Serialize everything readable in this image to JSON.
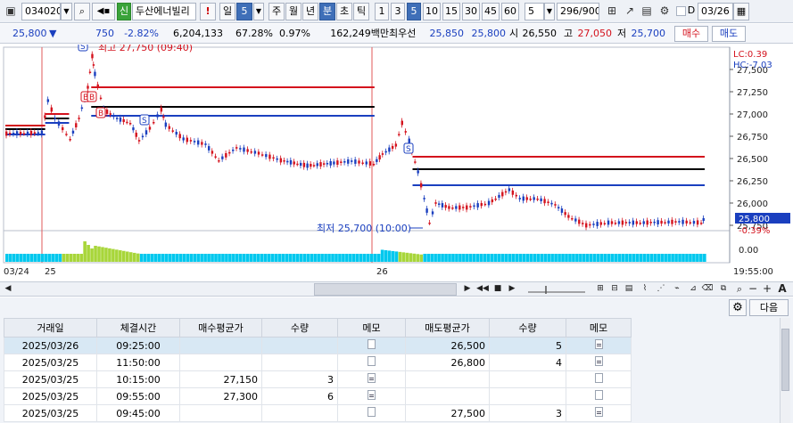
{
  "toolbar": {
    "code": "034020",
    "name_badge": "신",
    "name": "두산에너빌리",
    "warn": "!",
    "periods": [
      "일",
      "5",
      "주",
      "월",
      "년",
      "분",
      "초",
      "틱",
      "1",
      "3",
      "5",
      "10",
      "15",
      "30",
      "45",
      "60",
      "5"
    ],
    "count": "296/900",
    "date_check_label": "D",
    "date": "03/26"
  },
  "price_row": {
    "price": "25,800",
    "down_arrow": "▼",
    "change": "750",
    "change_pct": "-2.82%",
    "volume": "6,204,133",
    "vol_ratio": "67.28%",
    "turnover": "0.97%",
    "amount": "162,249백만",
    "best_label": "최우선",
    "best_ask": "25,850",
    "best_bid": "25,800",
    "open_label": "시",
    "open": "26,550",
    "high_label": "고",
    "high": "27,050",
    "low_label": "저",
    "low": "25,700",
    "buy_label": "매수",
    "sell_label": "매도"
  },
  "colors": {
    "up": "#d4121d",
    "down": "#1a3fbf",
    "volume": "#00c8ee",
    "volume_green": "#a8d63a",
    "accent": "#3f6fb8"
  },
  "chart_data": {
    "type": "line",
    "title": "",
    "y_ticks": [
      "27,500",
      "27,250",
      "27,000",
      "26,750",
      "26,500",
      "26,250",
      "26,000",
      "25,750"
    ],
    "ylim": [
      25700,
      27750
    ],
    "x_labels": [
      "03/24",
      "25",
      "26"
    ],
    "time_label": "19:55:00",
    "lc_label": "LC:0.39",
    "hc_label": "HC:-7.03",
    "current_price": "25,800",
    "current_pct": "-0.39%",
    "annotations": {
      "high": "최고 27,750 (09:40)",
      "low": "최저 25,700 (10:00)"
    },
    "volume_axis_label": "0.00",
    "signals": [
      "S",
      "B",
      "B",
      "B",
      "S",
      "S"
    ],
    "series": [
      {
        "name": "",
        "color": "#d4121d",
        "segments": [
          {
            "x": [
              0,
              45
            ],
            "y": 26870
          },
          {
            "x": [
              45,
              72
            ],
            "y": 27000
          },
          {
            "x": [
              97,
              417
            ],
            "y": 27300
          },
          {
            "x": [
              460,
              790
            ],
            "y": 26520
          }
        ]
      },
      {
        "name": "",
        "color": "#000000",
        "segments": [
          {
            "x": [
              0,
              45
            ],
            "y": 26830
          },
          {
            "x": [
              45,
              72
            ],
            "y": 26950
          },
          {
            "x": [
              97,
              417
            ],
            "y": 27080
          },
          {
            "x": [
              460,
              790
            ],
            "y": 26380
          }
        ]
      },
      {
        "name": "",
        "color": "#1a3fbf",
        "segments": [
          {
            "x": [
              0,
              45
            ],
            "y": 26770
          },
          {
            "x": [
              45,
              72
            ],
            "y": 26900
          },
          {
            "x": [
              97,
              417
            ],
            "y": 26980
          },
          {
            "x": [
              460,
              790
            ],
            "y": 26200
          }
        ]
      }
    ],
    "price_path": [
      [
        0,
        26780
      ],
      [
        40,
        26790
      ],
      [
        47,
        27150
      ],
      [
        55,
        26950
      ],
      [
        72,
        26720
      ],
      [
        82,
        26950
      ],
      [
        92,
        27300
      ],
      [
        97,
        27650
      ],
      [
        100,
        27450
      ],
      [
        110,
        27050
      ],
      [
        125,
        26950
      ],
      [
        140,
        26900
      ],
      [
        150,
        26700
      ],
      [
        162,
        26840
      ],
      [
        175,
        27050
      ],
      [
        180,
        26880
      ],
      [
        200,
        26720
      ],
      [
        225,
        26660
      ],
      [
        240,
        26480
      ],
      [
        260,
        26620
      ],
      [
        285,
        26560
      ],
      [
        310,
        26480
      ],
      [
        340,
        26420
      ],
      [
        370,
        26450
      ],
      [
        390,
        26470
      ],
      [
        415,
        26440
      ],
      [
        425,
        26550
      ],
      [
        440,
        26650
      ],
      [
        447,
        26900
      ],
      [
        455,
        26700
      ],
      [
        465,
        26350
      ],
      [
        472,
        26050
      ],
      [
        478,
        25780
      ],
      [
        485,
        26000
      ],
      [
        500,
        25950
      ],
      [
        520,
        25950
      ],
      [
        545,
        26000
      ],
      [
        568,
        26150
      ],
      [
        580,
        26050
      ],
      [
        600,
        26050
      ],
      [
        620,
        25980
      ],
      [
        635,
        25850
      ],
      [
        655,
        25750
      ],
      [
        680,
        25780
      ],
      [
        720,
        25780
      ],
      [
        760,
        25790
      ],
      [
        785,
        25780
      ],
      [
        790,
        25850
      ]
    ]
  },
  "nav": {
    "first": "◀◀",
    "stop": "■",
    "play": "▶",
    "last": "▶|",
    "plus": "+",
    "minus": "−",
    "zoom_a": "A"
  },
  "bottom": {
    "next_label": "다음",
    "columns": [
      "거래일",
      "체결시간",
      "매수평균가",
      "수량",
      "메모",
      "매도평균가",
      "수량",
      "메모"
    ],
    "rows": [
      {
        "date": "2025/03/26",
        "time": "09:25:00",
        "buy_avg": "",
        "buy_qty": "",
        "buy_memo": "blank",
        "sell_avg": "26,500",
        "sell_qty": "5",
        "sell_memo": "filled",
        "highlight": "true"
      },
      {
        "date": "2025/03/25",
        "time": "11:50:00",
        "buy_avg": "",
        "buy_qty": "",
        "buy_memo": "blank",
        "sell_avg": "26,800",
        "sell_qty": "4",
        "sell_memo": "filled",
        "highlight": "false"
      },
      {
        "date": "2025/03/25",
        "time": "10:15:00",
        "buy_avg": "27,150",
        "buy_qty": "3",
        "buy_memo": "filled",
        "sell_avg": "",
        "sell_qty": "",
        "sell_memo": "blank",
        "highlight": "false"
      },
      {
        "date": "2025/03/25",
        "time": "09:55:00",
        "buy_avg": "27,300",
        "buy_qty": "6",
        "buy_memo": "filled",
        "sell_avg": "",
        "sell_qty": "",
        "sell_memo": "blank",
        "highlight": "false"
      },
      {
        "date": "2025/03/25",
        "time": "09:45:00",
        "buy_avg": "",
        "buy_qty": "",
        "buy_memo": "blank",
        "sell_avg": "27,500",
        "sell_qty": "3",
        "sell_memo": "filled",
        "highlight": "false"
      }
    ]
  }
}
